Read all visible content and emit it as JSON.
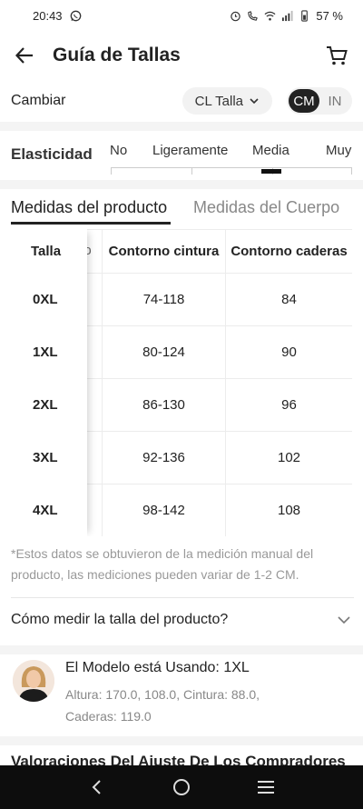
{
  "status_bar": {
    "time": "20:43",
    "battery": "57 %"
  },
  "header": {
    "title": "Guía de Tallas"
  },
  "unit_row": {
    "label": "Cambiar",
    "size_system": "CL Talla",
    "units": [
      "CM",
      "IN"
    ],
    "active_unit": "CM"
  },
  "elasticity": {
    "label": "Elasticidad",
    "options": [
      "No",
      "Ligeramente",
      "Media",
      "Muy"
    ],
    "selected": "Media"
  },
  "tabs": [
    {
      "label": "Medidas del producto",
      "active": true
    },
    {
      "label": "Medidas del Cuerpo",
      "active": false
    }
  ],
  "table": {
    "headers": [
      "Talla",
      "Contorno cintura",
      "Contorno caderas"
    ],
    "rows": [
      {
        "size": "0XL",
        "waist": "74-118",
        "hips": "84"
      },
      {
        "size": "1XL",
        "waist": "80-124",
        "hips": "90"
      },
      {
        "size": "2XL",
        "waist": "86-130",
        "hips": "96"
      },
      {
        "size": "3XL",
        "waist": "92-136",
        "hips": "102"
      },
      {
        "size": "4XL",
        "waist": "98-142",
        "hips": "108"
      }
    ]
  },
  "note": "*Estos datos se obtuvieron de la medición manual del producto, las mediciones pueden variar de 1-2 CM.",
  "howto": {
    "label": "Cómo medir la talla del producto?"
  },
  "model": {
    "title": "El Modelo está Usando: 1XL",
    "details_line1": "Altura: 170.0,   108.0,  Cintura: 88.0,",
    "details_line2": "Caderas: 119.0"
  },
  "next_section_title": "Valoraciones Del Ajuste De Los Compradores",
  "colors": {
    "accent": "#222222",
    "muted": "#999999",
    "nav_bar": "#0d0d0d"
  }
}
